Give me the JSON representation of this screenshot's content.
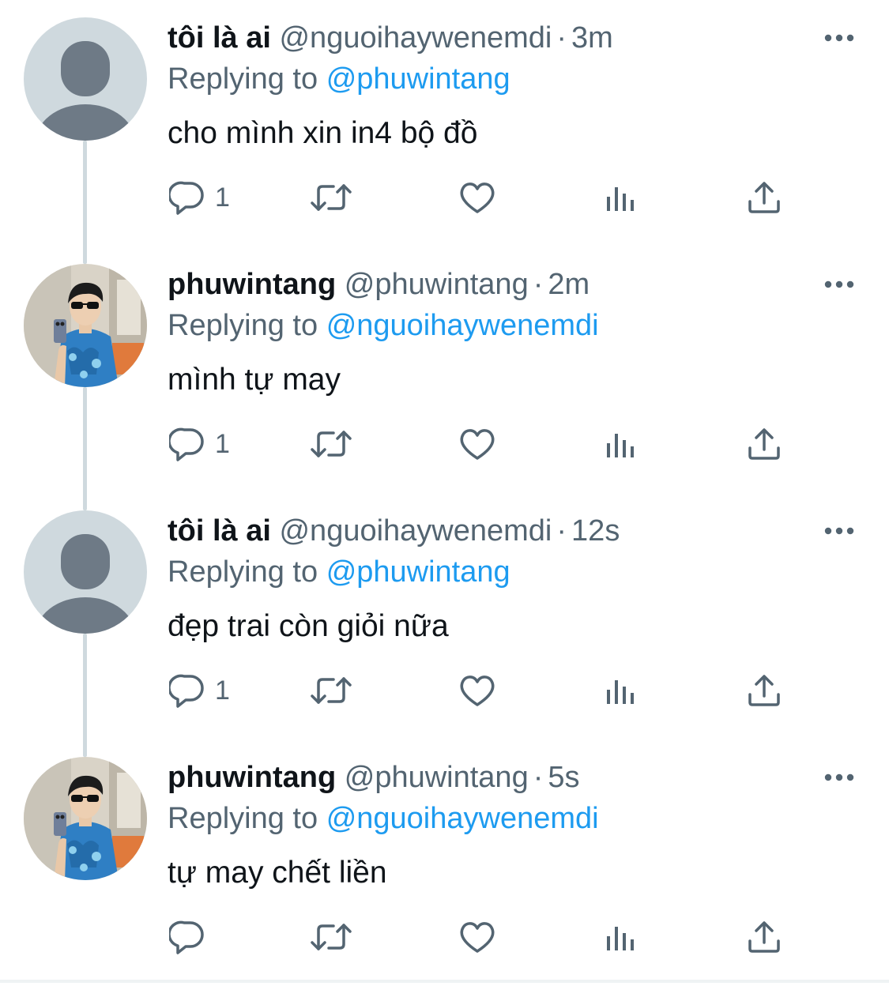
{
  "colors": {
    "accent": "#1d9bf0",
    "secondary_text": "#536471",
    "primary_text": "#0f1419",
    "thread_line": "#cfd9de",
    "default_avatar_bg": "#cfd9de",
    "default_avatar_fg": "#6e7a86"
  },
  "tweets": [
    {
      "name": "tôi là ai",
      "handle": "@nguoihaywenemdi",
      "separator": "·",
      "time": "3m",
      "replying_prefix": "Replying to",
      "replying_to": "@phuwintang",
      "text": "cho mình xin in4 bộ đồ",
      "reply_count": "1",
      "avatar": "default-avatar-icon"
    },
    {
      "name": "phuwintang",
      "handle": "@phuwintang",
      "separator": "·",
      "time": "2m",
      "replying_prefix": "Replying to",
      "replying_to": "@nguoihaywenemdi",
      "text": "mình tự may",
      "reply_count": "1",
      "avatar": "profile-photo"
    },
    {
      "name": "tôi là ai",
      "handle": "@nguoihaywenemdi",
      "separator": "·",
      "time": "12s",
      "replying_prefix": "Replying to",
      "replying_to": "@phuwintang",
      "text": "đẹp trai còn giỏi nữa",
      "reply_count": "1",
      "avatar": "default-avatar-icon"
    },
    {
      "name": "phuwintang",
      "handle": "@phuwintang",
      "separator": "·",
      "time": "5s",
      "replying_prefix": "Replying to",
      "replying_to": "@nguoihaywenemdi",
      "text": "tự may chết liền",
      "reply_count": "",
      "avatar": "profile-photo"
    }
  ],
  "action_icons": [
    "reply-icon",
    "retweet-icon",
    "like-icon",
    "views-icon",
    "share-icon"
  ]
}
